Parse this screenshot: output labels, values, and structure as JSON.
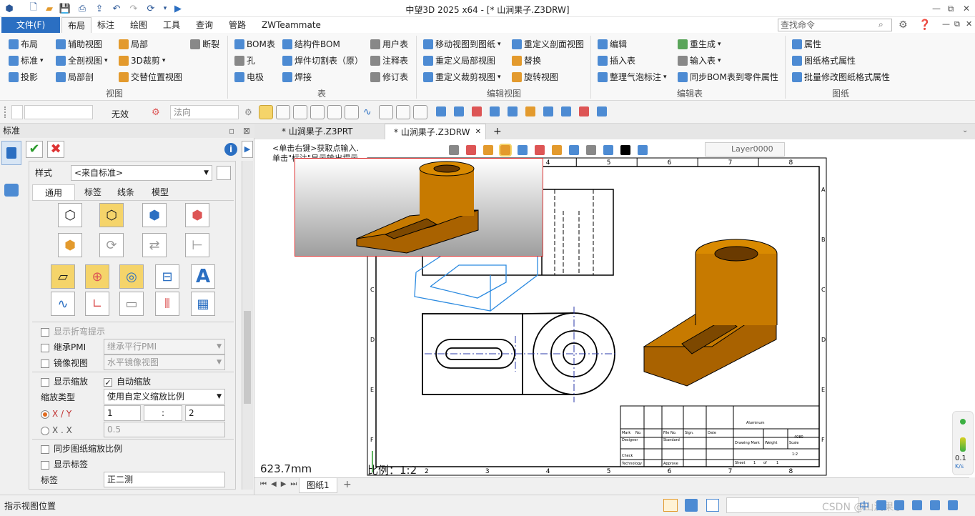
{
  "window": {
    "title": "中望3D 2025 x64 - [* 山涧果子.Z3DRW]",
    "controls": [
      "—",
      "⧉",
      "✕"
    ]
  },
  "menubar": {
    "file": "文件(F)",
    "tabs": [
      "布局",
      "标注",
      "绘图",
      "工具",
      "查询",
      "管路",
      "ZWTeammate"
    ],
    "active_tab": "布局",
    "search_placeholder": "查找命令"
  },
  "ribbon": {
    "groups": {
      "view": "视图",
      "table": "表",
      "edit_view": "编辑视图",
      "edit_table": "编辑表",
      "sheet": "图纸"
    },
    "view": {
      "layout": "布局",
      "aux_view": "辅助视图",
      "partial": "局部",
      "break": "断裂",
      "standard": "标准",
      "full_section": "全剖视图",
      "crop3d": "3D裁剪",
      "projection": "投影",
      "partial_section": "局部剖",
      "alt_position": "交替位置视图"
    },
    "table": {
      "bom": "BOM表",
      "struct_bom": "结构件BOM",
      "user_table": "用户表",
      "hole": "孔",
      "weld_cut": "焊件切割表（原）",
      "note_table": "注释表",
      "pole": "电极",
      "weld": "焊接",
      "revision": "修订表"
    },
    "edit_view": {
      "move_to_sheet": "移动视图到图纸",
      "redefine_section": "重定义剖面视图",
      "redefine_partial": "重定义局部视图",
      "replace": "替换",
      "redefine_crop": "重定义裁剪视图",
      "rotate": "旋转视图"
    },
    "edit_table": {
      "edit": "编辑",
      "regenerate": "重生成",
      "insert_table": "插入表",
      "input_table": "输入表",
      "arrange_balloons": "整理气泡标注",
      "sync_bom": "同步BOM表到零件属性"
    },
    "sheet": {
      "properties": "属性",
      "format_props": "图纸格式属性",
      "batch_format": "批量修改图纸格式属性"
    }
  },
  "toolbar2": {
    "invalid": "无效",
    "normal": "法向"
  },
  "left_panel": {
    "header": "标准",
    "style_label": "样式",
    "style_value": "<来自标准>",
    "tabs": [
      "通用",
      "标签",
      "线条",
      "模型"
    ],
    "show_bend": "显示折弯提示",
    "inherit_pmi": "继承PMI",
    "inherit_pmi_value": "继承平行PMI",
    "mirror_view": "镜像视图",
    "mirror_value": "水平镜像视图",
    "show_scale": "显示缩放",
    "auto_scale": "自动缩放",
    "scale_type_label": "缩放类型",
    "scale_type_value": "使用自定义缩放比例",
    "xy_label": "X / Y",
    "xy_num": "1",
    "xy_sep": ":",
    "xy_den": "2",
    "xx_label": "X . X",
    "xx_value": "0.5",
    "sync_sheet_scale": "同步图纸缩放比例",
    "show_label": "显示标签",
    "label_label": "标签",
    "label_value": "正二测"
  },
  "doc_tabs": [
    "* 山涧果子.Z3PRT",
    "* 山涧果子.Z3DRW"
  ],
  "canvas": {
    "prompt1": "<单击右键>获取点输入.",
    "prompt2": "单击\"标注\"显示输出提示",
    "layer": "Layer0000",
    "distance": "623.7mm",
    "scale_label": "比例：",
    "scale_value": "1:2",
    "columns": [
      "2",
      "3",
      "4",
      "5",
      "6",
      "7",
      "8"
    ],
    "rows": [
      "A",
      "B",
      "C",
      "D",
      "E",
      "F"
    ],
    "title_block": {
      "material": "Aluminum",
      "code": "4080",
      "drawing_mark": "Drawing Mark",
      "weight": "Weight",
      "scale": "Scale",
      "scale_val": "1:2",
      "designer": "Designer",
      "standard": "Standard",
      "check": "Check",
      "approve": "Approve",
      "technology": "Technology",
      "sheet": "Sheet",
      "sheet_num": "1",
      "of": "of",
      "sheet_total": "1",
      "mark": "Mark",
      "no": "No.",
      "file_no": "File No.",
      "sign": "Sign.",
      "date": "Date"
    }
  },
  "sheet_tab": "图纸1",
  "status": {
    "text": "指示视图位置",
    "watermark": "CSDN @山涧果子",
    "ime": "中",
    "speed": "0.1",
    "speed_unit": "K/s"
  }
}
